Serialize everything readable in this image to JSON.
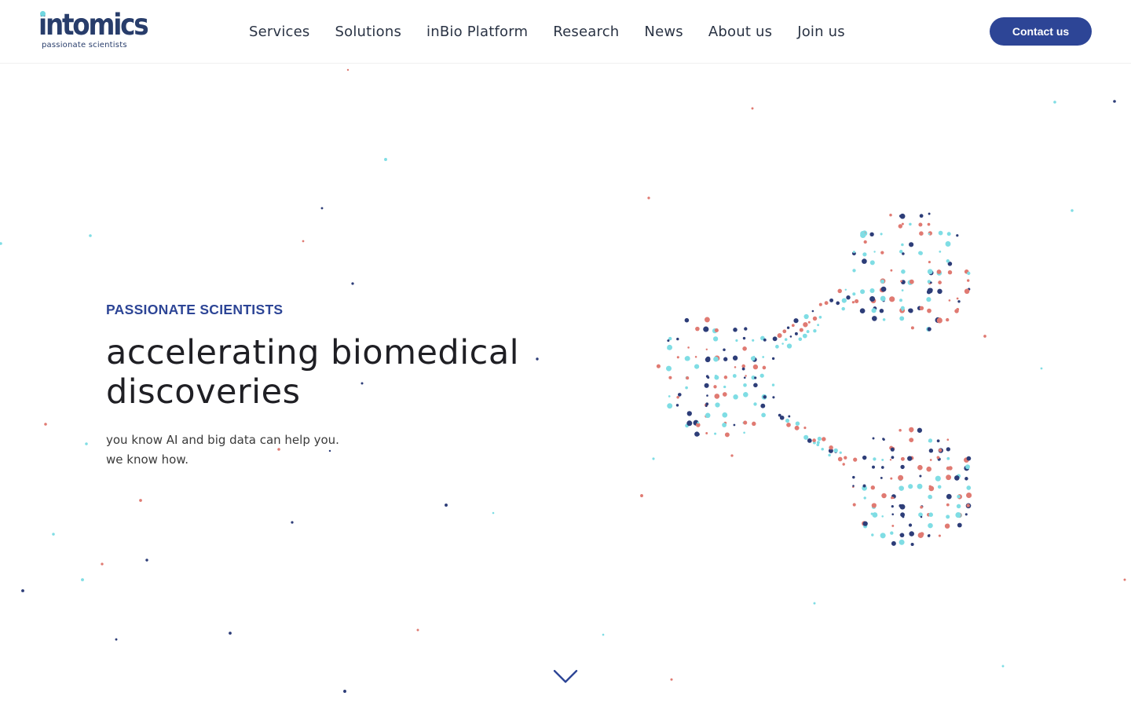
{
  "brand": {
    "logo_text": "intomics",
    "tagline": "passionate scientists"
  },
  "nav": {
    "items": [
      {
        "label": "Services"
      },
      {
        "label": "Solutions"
      },
      {
        "label": "inBio Platform"
      },
      {
        "label": "Research"
      },
      {
        "label": "News"
      },
      {
        "label": "About us"
      },
      {
        "label": "Join us"
      }
    ],
    "contact_label": "Contact us"
  },
  "hero": {
    "eyebrow": "PASSIONATE SCIENTISTS",
    "title_line1": "accelerating biomedical",
    "title_line2": "discoveries",
    "sub_line1": "you know AI and big data can help you.",
    "sub_line2": "we know how."
  },
  "colors": {
    "brand_navy": "#283d6b",
    "accent_blue": "#2d4596",
    "dot_coral": "#e07a72",
    "dot_cyan": "#7fdde4",
    "dot_navy": "#2d3d78"
  },
  "icons": {
    "scroll": "chevron-down-icon",
    "illustration": "molecule-network-illustration"
  }
}
